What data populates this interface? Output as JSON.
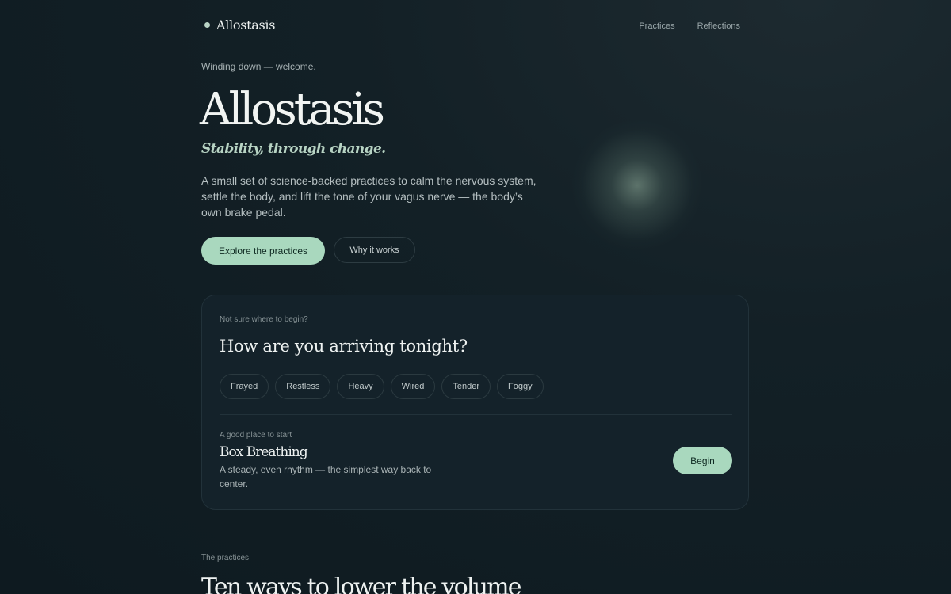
{
  "nav": {
    "brand": "Allostasis",
    "links": [
      "Practices",
      "Reflections"
    ]
  },
  "hero": {
    "greeting": "Winding down — welcome.",
    "title": "Allostasis",
    "tagline": "Stability, through change.",
    "intro": "A small set of science-backed practices to calm the nervous system, settle the body, and lift the tone of your vagus nerve — the body’s own brake pedal.",
    "primary_cta": "Explore the practices",
    "secondary_cta": "Why it works"
  },
  "checkin": {
    "eyebrow": "Not sure where to begin?",
    "question": "How are you arriving tonight?",
    "moods": [
      "Frayed",
      "Restless",
      "Heavy",
      "Wired",
      "Tender",
      "Foggy"
    ],
    "recommendation": {
      "eyebrow": "A good place to start",
      "title": "Box Breathing",
      "description": "A steady, even rhythm — the simplest way back to center.",
      "button": "Begin"
    }
  },
  "practices": {
    "eyebrow": "The practices",
    "title": "Ten ways to lower the volume"
  },
  "colors": {
    "background": "#0e1a20",
    "accent": "#a9d8be",
    "card": "#14222a"
  }
}
